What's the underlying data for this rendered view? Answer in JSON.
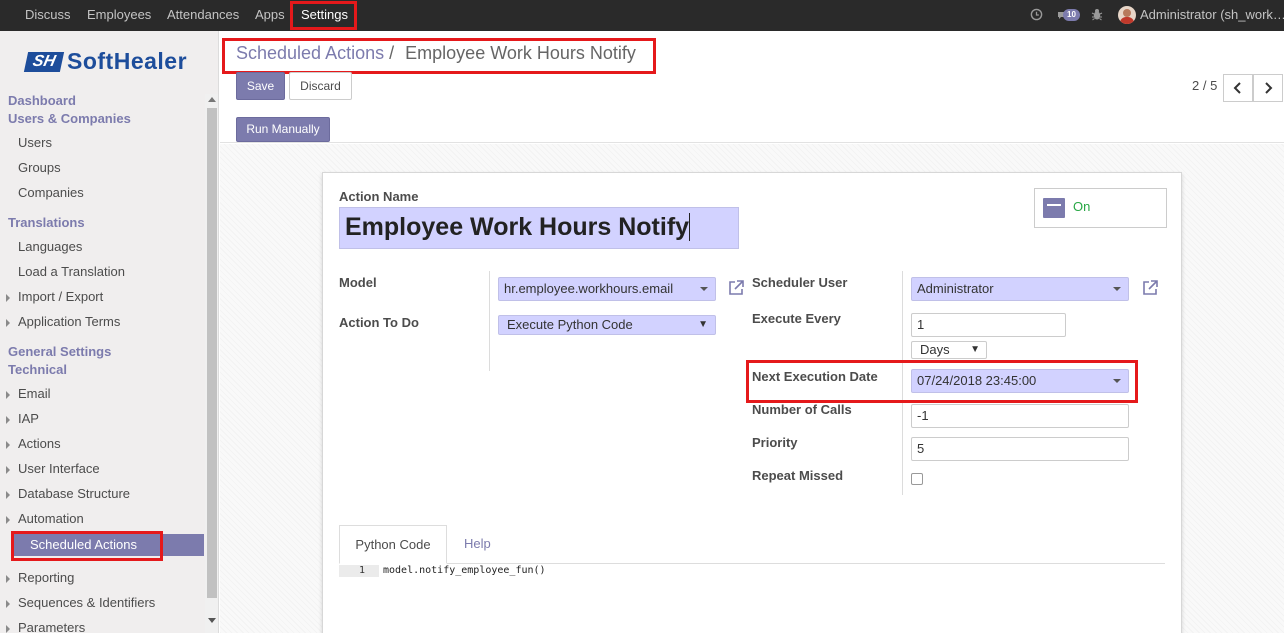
{
  "navbar": {
    "menu": [
      "Discuss",
      "Employees",
      "Attendances",
      "Apps",
      "Settings"
    ],
    "active": "Settings",
    "message_count": "10",
    "user": "Administrator (sh_work…"
  },
  "brand": {
    "mark": "SH",
    "name": "SoftHealer"
  },
  "sidebar": {
    "dashboard": "Dashboard",
    "users_companies": "Users & Companies",
    "users": "Users",
    "groups": "Groups",
    "companies": "Companies",
    "translations": "Translations",
    "languages": "Languages",
    "load_translation": "Load a Translation",
    "import_export": "Import / Export",
    "application_terms": "Application Terms",
    "general_settings": "General Settings",
    "technical": "Technical",
    "email": "Email",
    "iap": "IAP",
    "actions": "Actions",
    "user_interface": "User Interface",
    "database_structure": "Database Structure",
    "automation": "Automation",
    "scheduled_actions": "Scheduled Actions",
    "reporting": "Reporting",
    "sequences": "Sequences & Identifiers",
    "parameters": "Parameters"
  },
  "breadcrumb": {
    "parent": "Scheduled Actions",
    "separator": "/",
    "current": "Employee Work Hours Notify"
  },
  "buttons": {
    "save": "Save",
    "discard": "Discard",
    "run_manually": "Run Manually"
  },
  "pager": {
    "value": "2 / 5"
  },
  "form": {
    "action_name_label": "Action Name",
    "action_name": "Employee Work Hours Notify",
    "active_label": "On",
    "model_label": "Model",
    "model": "hr.employee.workhours.email",
    "action_to_do_label": "Action To Do",
    "action_to_do": "Execute Python Code",
    "scheduler_user_label": "Scheduler User",
    "scheduler_user": "Administrator",
    "execute_every_label": "Execute Every",
    "execute_every": "1",
    "interval_unit": "Days",
    "next_exec_label": "Next Execution Date",
    "next_exec": "07/24/2018 23:45:00",
    "number_of_calls_label": "Number of Calls",
    "number_of_calls": "-1",
    "priority_label": "Priority",
    "priority": "5",
    "repeat_missed_label": "Repeat Missed",
    "repeat_missed": false
  },
  "tabs": {
    "python_code": "Python Code",
    "help": "Help"
  },
  "code": {
    "line_no": "1",
    "line": "model.notify_employee_fun()"
  },
  "colors": {
    "accent": "#7c7bad",
    "highlight": "#e5191b",
    "field_bg": "#d2d2ff",
    "navbar": "#2a2a2a"
  }
}
